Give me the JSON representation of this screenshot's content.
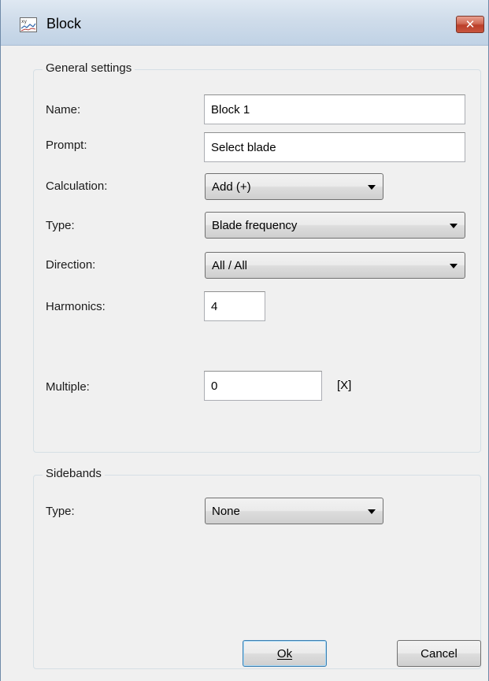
{
  "window": {
    "title": "Block",
    "close_label": "✕"
  },
  "general": {
    "title": "General settings",
    "name": {
      "label": "Name:",
      "value": "Block 1"
    },
    "prompt": {
      "label": "Prompt:",
      "value": "Select blade"
    },
    "calculation": {
      "label": "Calculation:",
      "value": "Add (+)"
    },
    "type": {
      "label": "Type:",
      "value": "Blade frequency"
    },
    "direction": {
      "label": "Direction:",
      "value": "All / All"
    },
    "harmonics": {
      "label": "Harmonics:",
      "value": "4"
    },
    "multiple": {
      "label": "Multiple:",
      "value": "0",
      "unit": "[X]"
    }
  },
  "sidebands": {
    "title": "Sidebands",
    "type": {
      "label": "Type:",
      "value": "None"
    }
  },
  "buttons": {
    "ok": "Ok",
    "cancel": "Cancel"
  },
  "icons": {
    "app": "xy-chart-icon",
    "close": "close-icon",
    "dropdown": "chevron-down-icon"
  },
  "colors": {
    "close_button": "#c8553d",
    "title_bar": "#cfdcea",
    "dialog_background": "#f0f0f0"
  }
}
